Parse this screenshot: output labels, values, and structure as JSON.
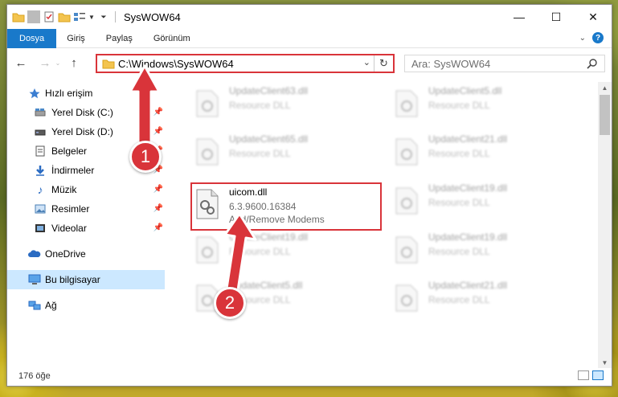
{
  "window": {
    "title": "SysWOW64"
  },
  "ribbon": {
    "tabs": [
      "Dosya",
      "Giriş",
      "Paylaş",
      "Görünüm"
    ]
  },
  "address": {
    "path": "C:\\Windows\\SysWOW64"
  },
  "search": {
    "placeholder": "Ara: SysWOW64"
  },
  "sidebar": {
    "items": [
      {
        "label": "Hızlı erişim",
        "icon": "star-icon"
      },
      {
        "label": "Yerel Disk (C:)",
        "icon": "drive-icon",
        "pinned": true
      },
      {
        "label": "Yerel Disk (D:)",
        "icon": "drive-icon",
        "pinned": true
      },
      {
        "label": "Belgeler",
        "icon": "documents-icon",
        "pinned": true
      },
      {
        "label": "İndirmeler",
        "icon": "download-icon",
        "pinned": true
      },
      {
        "label": "Müzik",
        "icon": "music-icon",
        "pinned": true
      },
      {
        "label": "Resimler",
        "icon": "pictures-icon",
        "pinned": true
      },
      {
        "label": "Videolar",
        "icon": "videos-icon",
        "pinned": true
      },
      {
        "label": "OneDrive",
        "icon": "cloud-icon"
      },
      {
        "label": "Bu bilgisayar",
        "icon": "computer-icon",
        "selected": true
      },
      {
        "label": "Ağ",
        "icon": "network-icon"
      }
    ]
  },
  "files": {
    "left": [
      {
        "name": "UpdateClient63.dll",
        "type": "Resource DLL"
      },
      {
        "name": "UpdateClient65.dll",
        "type": "Resource DLL"
      },
      {
        "name": "UpdateClient19.dll",
        "type": "Resource DLL"
      },
      {
        "name": "UpdateClient5.dll",
        "type": "Resource DLL"
      }
    ],
    "right": [
      {
        "name": "UpdateClient5.dll",
        "type": "Resource DLL"
      },
      {
        "name": "UpdateClient21.dll",
        "type": "Resource DLL"
      },
      {
        "name": "UpdateClient19.dll",
        "type": "Resource DLL"
      },
      {
        "name": "UpdateClient19.dll",
        "type": "Resource DLL"
      },
      {
        "name": "UpdateClient21.dll",
        "type": "Resource DLL"
      }
    ],
    "highlighted": {
      "name": "uicom.dll",
      "version": "6.3.9600.16384",
      "description": "Add/Remove Modems"
    }
  },
  "status": {
    "count": "176 öğe"
  },
  "annotations": {
    "step1": "1",
    "step2": "2",
    "color": "#d9343a"
  }
}
